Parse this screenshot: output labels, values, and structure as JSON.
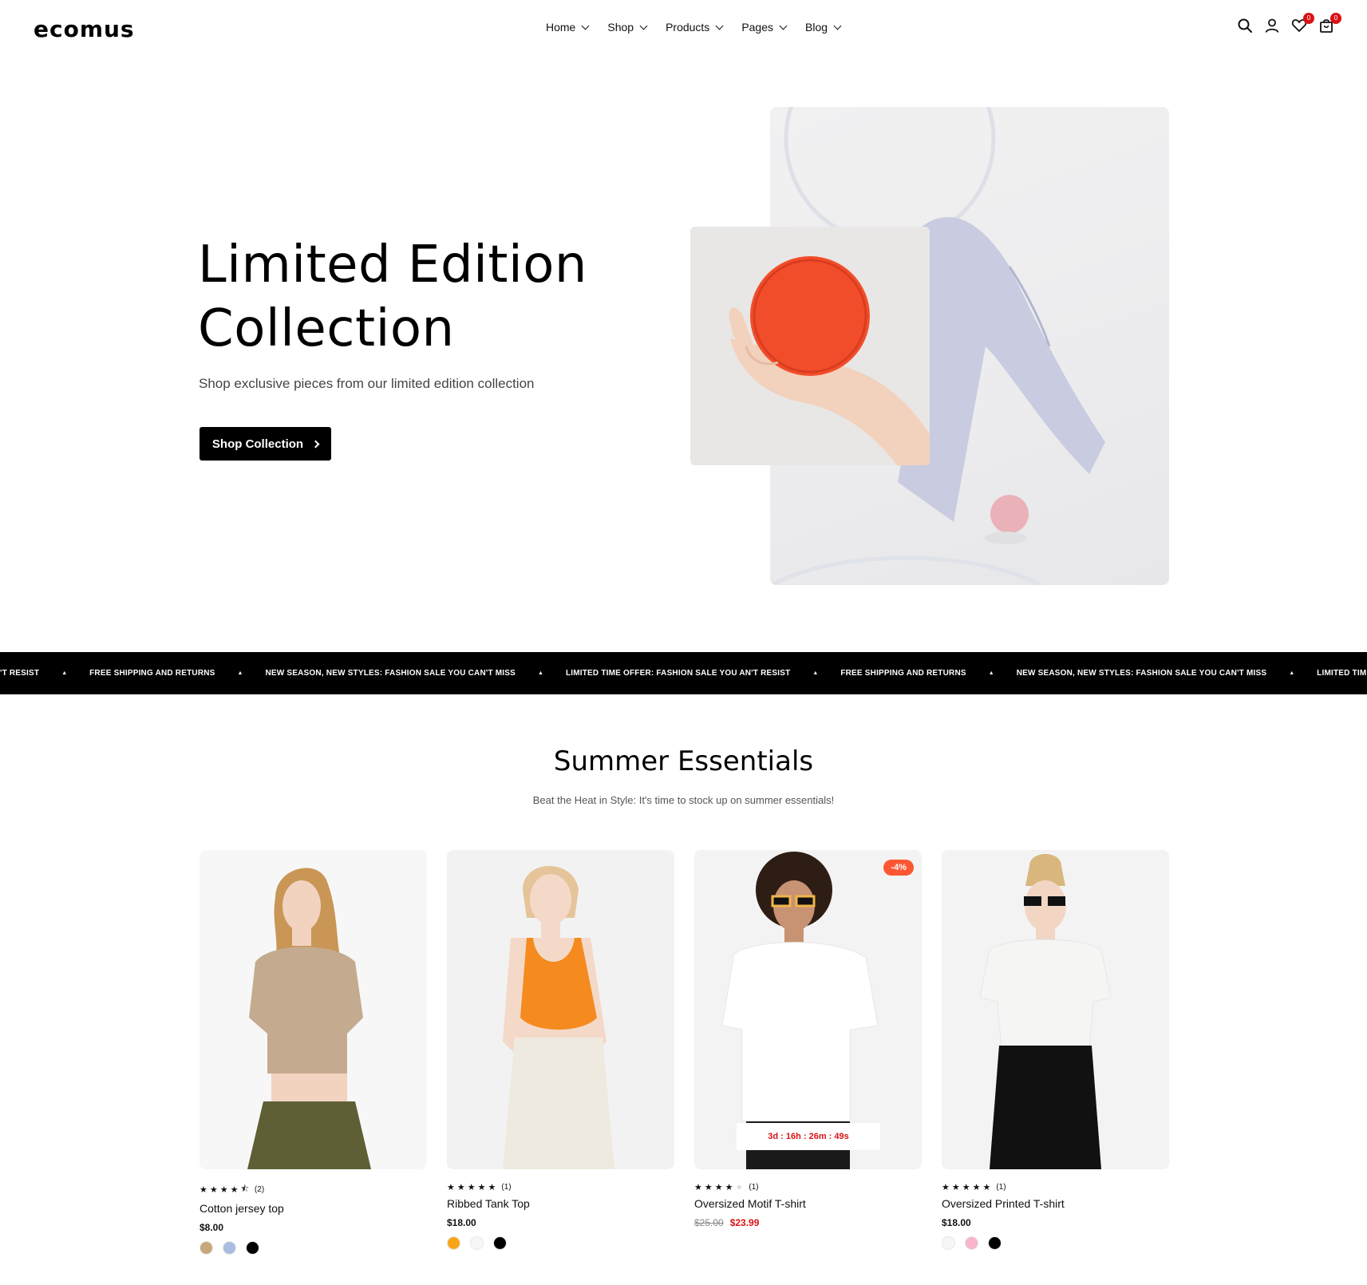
{
  "header": {
    "logo": "ecomus",
    "nav": [
      {
        "label": "Home"
      },
      {
        "label": "Shop"
      },
      {
        "label": "Products"
      },
      {
        "label": "Pages"
      },
      {
        "label": "Blog"
      }
    ],
    "wishlist_count": "0",
    "cart_count": "0",
    "icons": [
      "search-icon",
      "user-icon",
      "heart-icon",
      "bag-icon"
    ]
  },
  "hero": {
    "title_line1": "Limited Edition",
    "title_line2": "Collection",
    "subtitle": "Shop exclusive pieces from our limited edition collection",
    "cta_label": "Shop Collection"
  },
  "marquee": {
    "items": [
      "'T RESIST",
      "FREE SHIPPING AND RETURNS",
      "NEW SEASON, NEW STYLES: FASHION SALE YOU CAN'T MISS",
      "LIMITED TIME OFFER: FASHION SALE YOU AN'T RESIST",
      "FREE SHIPPING AND RETURNS",
      "NEW SEASON, NEW STYLES: FASHION SALE YOU CAN'T MISS",
      "LIMITED TIME OFFER: FASHION SALE"
    ],
    "separator": "▲"
  },
  "section": {
    "title": "Summer Essentials",
    "subtitle": "Beat the Heat in Style: It's time to stock up on summer essentials!"
  },
  "products": [
    {
      "name": "Cotton jersey top",
      "rating": 4.5,
      "reviews": "(2)",
      "price": "$8.00",
      "swatches": [
        "#c9a77c",
        "#a8bde0",
        "#000000"
      ]
    },
    {
      "name": "Ribbed Tank Top",
      "rating": 5,
      "reviews": "(1)",
      "price": "$18.00",
      "swatches": [
        "#f9a51a",
        "#f7f7f7",
        "#000000"
      ]
    },
    {
      "name": "Oversized Motif T-shirt",
      "rating": 4,
      "reviews": "(1)",
      "old_price": "$25.00",
      "price": "$23.99",
      "badge": "-4%",
      "countdown": "3d : 16h : 26m : 49s"
    },
    {
      "name": "Oversized Printed T-shirt",
      "rating": 5,
      "reviews": "(1)",
      "price": "$18.00",
      "swatches": [
        "#f7f7f7",
        "#f6b5c8",
        "#000000"
      ]
    }
  ],
  "colors": {
    "accent": "#000000",
    "sale": "#db1215",
    "badge": "#fc5732"
  }
}
